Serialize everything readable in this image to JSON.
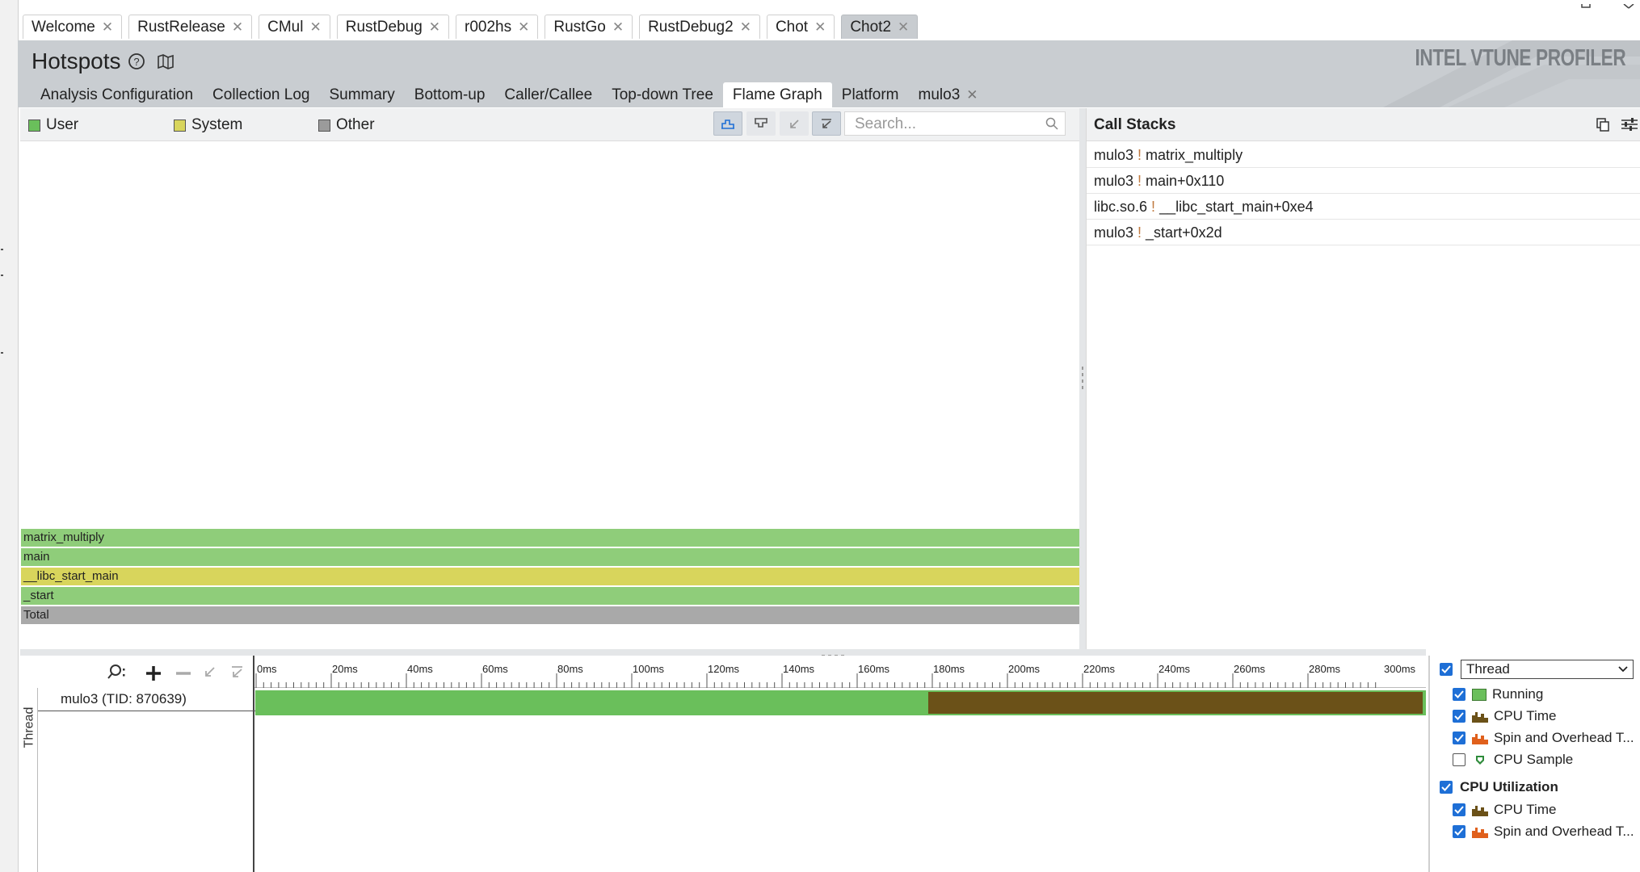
{
  "document_tabs": [
    {
      "label": "Welcome",
      "active": false
    },
    {
      "label": "RustRelease",
      "active": false
    },
    {
      "label": "CMul",
      "active": false
    },
    {
      "label": "RustDebug",
      "active": false
    },
    {
      "label": "r002hs",
      "active": false
    },
    {
      "label": "RustGo",
      "active": false
    },
    {
      "label": "RustDebug2",
      "active": false
    },
    {
      "label": "Chot",
      "active": false
    },
    {
      "label": "Chot2",
      "active": true
    }
  ],
  "header": {
    "title": "Hotspots",
    "brand": "INTEL VTUNE PROFILER"
  },
  "analysis_tabs": {
    "analysis_configuration": "Analysis Configuration",
    "collection_log": "Collection Log",
    "summary": "Summary",
    "bottom_up": "Bottom-up",
    "caller_callee": "Caller/Callee",
    "top_down_tree": "Top-down Tree",
    "flame_graph": "Flame Graph",
    "platform": "Platform",
    "mulo3": "mulo3",
    "active": "Flame Graph"
  },
  "flame_legend": {
    "user": {
      "label": "User",
      "color": "#6abf5b"
    },
    "system": {
      "label": "System",
      "color": "#d8d55c"
    },
    "other": {
      "label": "Other",
      "color": "#9b9b9b"
    }
  },
  "search": {
    "placeholder": "Search..."
  },
  "flame_graph": {
    "frames": [
      {
        "name": "matrix_multiply",
        "color": "#8fcd7a"
      },
      {
        "name": "main",
        "color": "#8fcd7a"
      },
      {
        "name": "__libc_start_main",
        "color": "#d8d55c"
      },
      {
        "name": "_start",
        "color": "#8fcd7a"
      },
      {
        "name": "Total",
        "color": "#a9a9a9"
      }
    ]
  },
  "call_stacks": {
    "title": "Call Stacks",
    "rows": [
      {
        "module": "mulo3",
        "function": "matrix_multiply"
      },
      {
        "module": "mulo3",
        "function": "main+0x110"
      },
      {
        "module": "libc.so.6",
        "function": "__libc_start_main+0xe4"
      },
      {
        "module": "mulo3",
        "function": "_start+0x2d"
      }
    ]
  },
  "timeline": {
    "ruler_labels": [
      "0ms",
      "20ms",
      "40ms",
      "60ms",
      "80ms",
      "100ms",
      "120ms",
      "140ms",
      "160ms",
      "180ms",
      "200ms",
      "220ms",
      "240ms",
      "260ms",
      "280ms",
      "300ms"
    ],
    "row_group_label": "Thread",
    "thread_name": "mulo3 (TID: 870639)",
    "running_color": "#6abf5b",
    "spin_color": "#6b5118"
  },
  "timeline_legend": {
    "group_select": "Thread",
    "thread_items": [
      {
        "label": "Running",
        "checked": true
      },
      {
        "label": "CPU Time",
        "checked": true
      },
      {
        "label": "Spin and Overhead T...",
        "checked": true
      },
      {
        "label": "CPU Sample",
        "checked": false
      }
    ],
    "cpu_util_title": "CPU Utilization",
    "cpu_util_items": [
      {
        "label": "CPU Time",
        "checked": true
      },
      {
        "label": "Spin and Overhead T...",
        "checked": true
      }
    ]
  }
}
